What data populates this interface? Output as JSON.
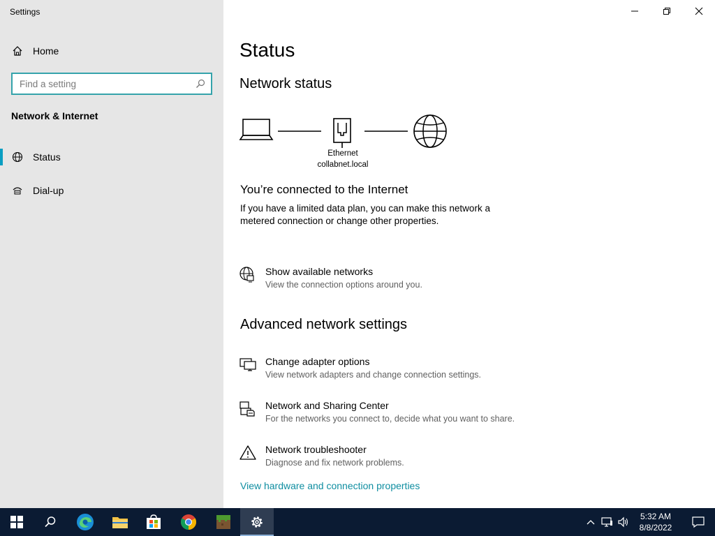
{
  "window": {
    "title": "Settings"
  },
  "sidebar": {
    "home_label": "Home",
    "search_placeholder": "Find a setting",
    "section": "Network & Internet",
    "items": [
      {
        "label": "Status",
        "icon": "globe-status-icon",
        "selected": true
      },
      {
        "label": "Dial-up",
        "icon": "dial-up-icon",
        "selected": false
      }
    ]
  },
  "main": {
    "title": "Status",
    "network_status_heading": "Network status",
    "diagram": {
      "adapter_name": "Ethernet",
      "network_name": "collabnet.local"
    },
    "connected_title": "You’re connected to the Internet",
    "connected_text_line1": "If you have a limited data plan, you can make this network a",
    "connected_text_line2": "metered connection or change other properties.",
    "show_networks": {
      "title": "Show available networks",
      "desc": "View the connection options around you."
    },
    "advanced_heading": "Advanced network settings",
    "advanced_items": [
      {
        "title": "Change adapter options",
        "desc": "View network adapters and change connection settings.",
        "icon": "adapter-icon"
      },
      {
        "title": "Network and Sharing Center",
        "desc": "For the networks you connect to, decide what you want to share.",
        "icon": "sharing-center-icon"
      },
      {
        "title": "Network troubleshooter",
        "desc": "Diagnose and fix network problems.",
        "icon": "warning-icon"
      }
    ],
    "hardware_link": "View hardware and connection properties"
  },
  "taskbar": {
    "time": "5:32 AM",
    "date": "8/8/2022",
    "colors": {
      "background": "#0b1b33",
      "accent": "#0f8ea1"
    }
  }
}
